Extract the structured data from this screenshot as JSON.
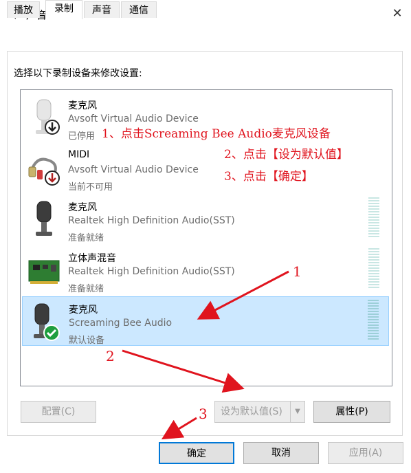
{
  "window": {
    "title": "声音",
    "close_glyph": "✕"
  },
  "tabs": [
    {
      "label": "播放",
      "active": false
    },
    {
      "label": "录制",
      "active": true
    },
    {
      "label": "声音",
      "active": false
    },
    {
      "label": "通信",
      "active": false
    }
  ],
  "instruction": "选择以下录制设备来修改设置:",
  "devices": [
    {
      "name": "麦克风",
      "driver": "Avsoft Virtual Audio Device",
      "status": "已停用",
      "icon": "microphone-disabled-icon",
      "selected": false,
      "level_meter": false
    },
    {
      "name": "MIDI",
      "driver": "Avsoft Virtual Audio Device",
      "status": "当前不可用",
      "icon": "midi-cable-unavailable-icon",
      "selected": false,
      "level_meter": false
    },
    {
      "name": "麦克风",
      "driver": "Realtek High Definition Audio(SST)",
      "status": "准备就绪",
      "icon": "microphone-icon",
      "selected": false,
      "level_meter": true
    },
    {
      "name": "立体声混音",
      "driver": "Realtek High Definition Audio(SST)",
      "status": "准备就绪",
      "icon": "sound-card-icon",
      "selected": false,
      "level_meter": true
    },
    {
      "name": "麦克风",
      "driver": "Screaming Bee Audio",
      "status": "默认设备",
      "icon": "microphone-default-icon",
      "selected": true,
      "level_meter": true
    }
  ],
  "annotations": {
    "step1": "1、点击Screaming Bee Audio麦克风设备",
    "step2": "2、点击【设为默认值】",
    "step3": "3、点击【确定】",
    "marker1": "1",
    "marker2": "2",
    "marker3": "3"
  },
  "buttons": {
    "configure": "配置(C)",
    "set_default": "设为默认值(S)",
    "set_default_dropdown": "▼",
    "properties": "属性(P)",
    "ok": "确定",
    "cancel": "取消",
    "apply": "应用(A)"
  },
  "colors": {
    "annotation_red": "#e0141e",
    "selection_bg": "#cce8ff",
    "selection_border": "#99d1ff",
    "primary_border": "#0078d7"
  }
}
